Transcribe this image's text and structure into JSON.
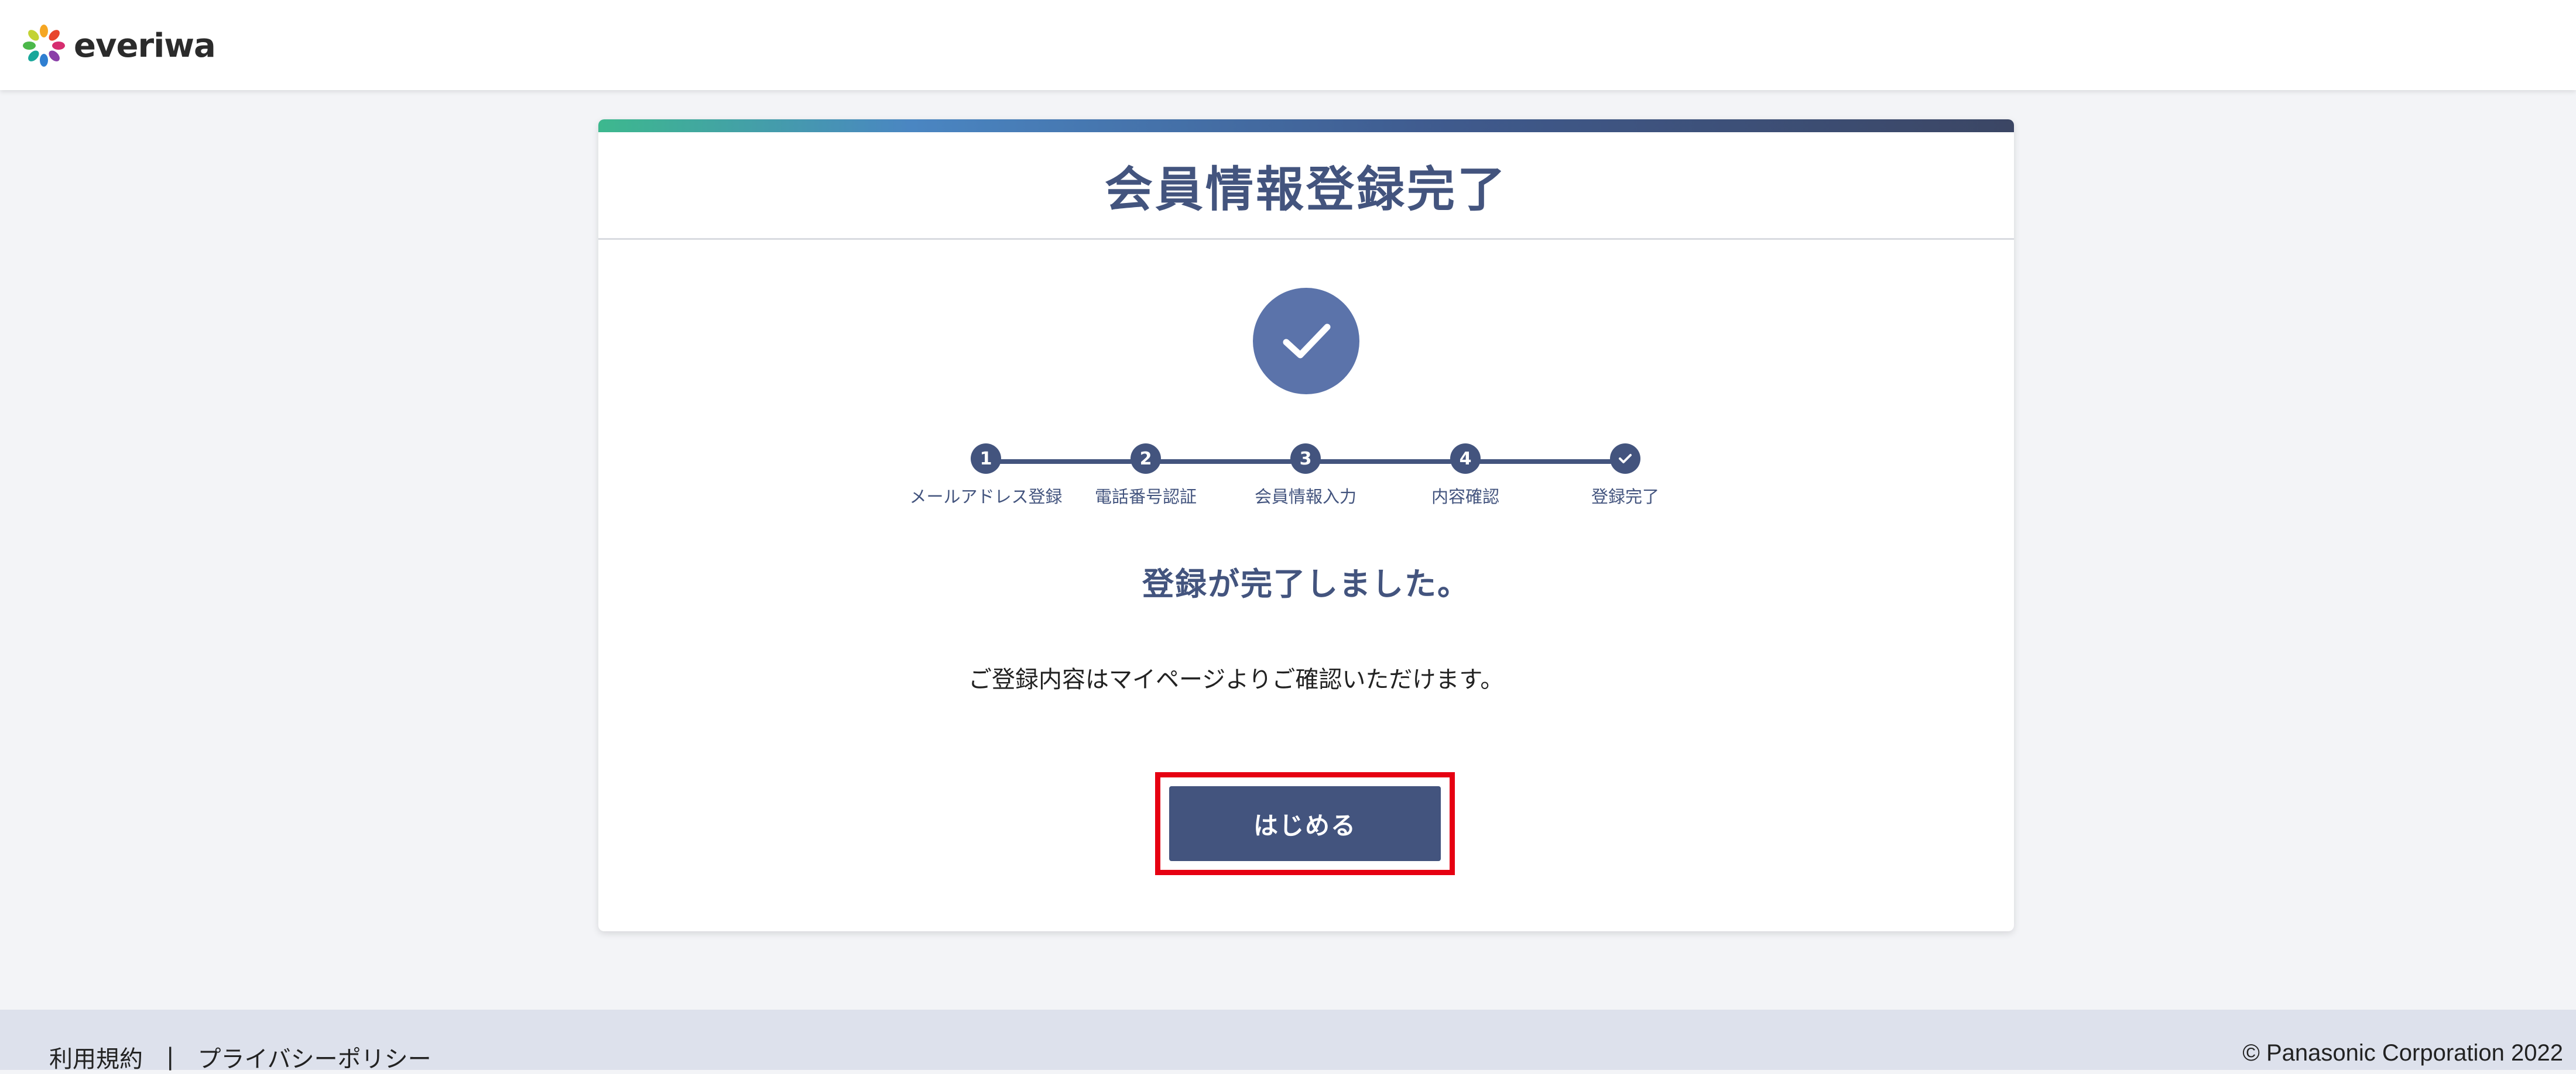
{
  "header": {
    "logo_text": "everiwa"
  },
  "card": {
    "title": "会員情報登録完了",
    "steps": [
      {
        "marker": "1",
        "label": "メールアドレス登録"
      },
      {
        "marker": "2",
        "label": "電話番号認証"
      },
      {
        "marker": "3",
        "label": "会員情報入力"
      },
      {
        "marker": "4",
        "label": "内容確認"
      },
      {
        "marker": "check-icon",
        "label": "登録完了"
      }
    ],
    "done_message": "登録が完了しました。",
    "sub_message": "ご登録内容はマイページよりご確認いただけます。",
    "start_button": "はじめる"
  },
  "footer": {
    "terms_link": "利用規約",
    "separator": "|",
    "privacy_link": "プライバシーポリシー",
    "copyright": "© Panasonic Corporation 2022"
  },
  "colors": {
    "primary": "#43547e",
    "check_circle": "#5b73aa",
    "highlight_border": "#e60012",
    "gradient_start": "#3db88e"
  }
}
